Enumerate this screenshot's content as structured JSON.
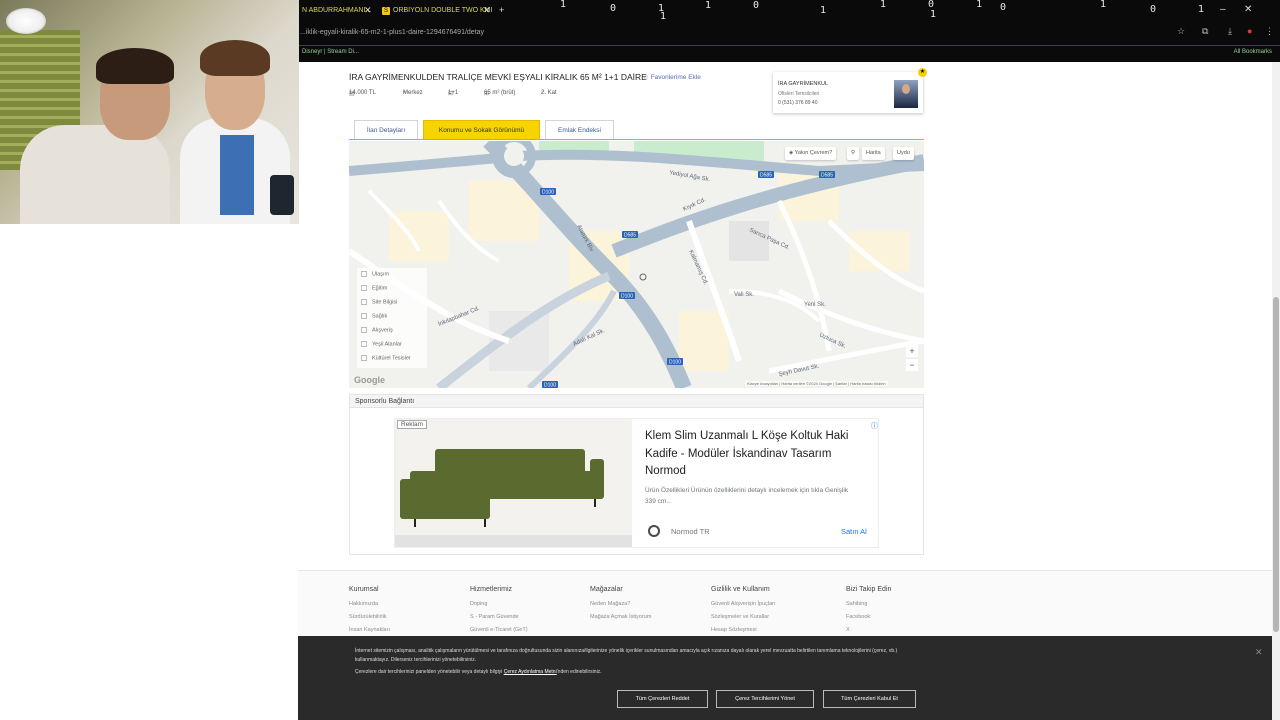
{
  "browser": {
    "tabs": [
      {
        "label": "N ABDURRAHMANI..."
      },
      {
        "label": "ORBIYOLN DOUBLE TWO KMI"
      }
    ],
    "url": "...iklik-egyali-kiralik-65-m2-1-plus1-daire-1294676491/detay",
    "bookmarks": "Disneyr | Stream Di...",
    "all_bookmarks": "All Bookmarks"
  },
  "listing": {
    "title": "İRA GAYRİMENKULDEN TRALİÇE MEVKİ EŞYALI KİRALIK 65 M² 1+1 DAİRE",
    "favorite_label": "Favorilerime Ekle",
    "price": "14.000 TL",
    "location": "Merkez",
    "rooms": "1+1",
    "area": "65 m² (brüt)",
    "floor": "2. Kat"
  },
  "agent": {
    "name": "İRA GAYRİMENKUL",
    "subtitle": "Ofisleri Temsilcileri",
    "phone": "0 (531) 376 89 40"
  },
  "page_tabs": {
    "details": "İlan Detayları",
    "location": "Konumu ve Sokak Görünümü",
    "value_index": "Emlak Endeksi"
  },
  "map": {
    "nearby_label": "Yakın Çevrem?",
    "map_label": "Harita",
    "satellite_label": "Uydu",
    "layers": [
      "Ulaşım",
      "Eğitim",
      "Site Bilgisi",
      "Sağlık",
      "Alışveriş",
      "Yeşil Alanlar",
      "Kültürel Tesisler"
    ],
    "streets": [
      "Atatürk Blv",
      "Kıyık Cd.",
      "Sarıca Paşa Cd.",
      "İnkılapbahar Cd.",
      "Adalı Kal Sk.",
      "Yediyol Ağa Sk.",
      "Kalmamış Cd.",
      "Vali Sk.",
      "Yeni Sk.",
      "Şeyh Davut Sk.",
      "Uzluca Sk."
    ],
    "road_codes": [
      "D100",
      "D100",
      "D100",
      "D100",
      "D585",
      "D585",
      "D585"
    ],
    "google_label": "Google",
    "attribution": "Klavye kısayolları | Harita verileri ©2024 Google | Şartlar | Harita hatası bildirin",
    "zoom_in": "+",
    "zoom_out": "−"
  },
  "sponsored": {
    "heading": "Sponsorlu Bağlantı",
    "ad_label": "Reklam",
    "ad_title": "Klem Slim Uzanmalı L Köşe Koltuk Haki Kadife - Modüler İskandinav Tasarım Normod",
    "ad_desc": "Ürün Özellikleri Ürünün özelliklerini detaylı incelemek için tıkla Genişlik 339 cm...",
    "ad_brand": "Normod TR",
    "ad_cta": "Satın Al",
    "sofa_color": "#5b6a2e"
  },
  "footer": {
    "columns": [
      {
        "heading": "Kurumsal",
        "items": [
          "Hakkımızda",
          "Sürdürülebilirlik",
          "İnsan Kaynakları"
        ]
      },
      {
        "heading": "Hizmetlerimiz",
        "items": [
          "Doping",
          "S - Param Güvende",
          "Güvenli e-Ticaret (GeT)"
        ]
      },
      {
        "heading": "Mağazalar",
        "items": [
          "Neden Mağaza?",
          "Mağaza Açmak İstiyorum"
        ]
      },
      {
        "heading": "Gizlilik ve Kullanım",
        "items": [
          "Güvenli Alışverişin İpuçları",
          "Sözleşmeler ve Kurallar",
          "Hesap Sözleşmesi"
        ]
      },
      {
        "heading": "Bizi Takip Edin",
        "items": [
          "Sahibing",
          "Facebook",
          "X"
        ]
      }
    ]
  },
  "cookie": {
    "text": "İnternet sitemizin çalışması, analitik çalışmaların yürütülmesi ve tarafınıza doğrultusunda sizin alanınıza/ilgilerinize yönelik içerikler sunulmasından amacıyla açık rızanıza dayalı olarak yerel mevzuatta belirtilen tanımlama teknolojilerini (çerez, vb.) kullanmaktayız. Dilerseniz tercihlerinizi yönetebilirsiniz.",
    "text2_prefix": "Çerezlere dair tercihlerinizi panelden yönetebilir veya detaylı bilgiyi",
    "text2_link": "Çerez Aydınlatma Metni",
    "text2_suffix": "'nden edinebilirsiniz.",
    "reject_label": "Tüm Çerezleri Reddet",
    "manage_label": "Çerez Tercihlerimi Yönet",
    "accept_label": "Tüm Çerezleri Kabul Et"
  }
}
